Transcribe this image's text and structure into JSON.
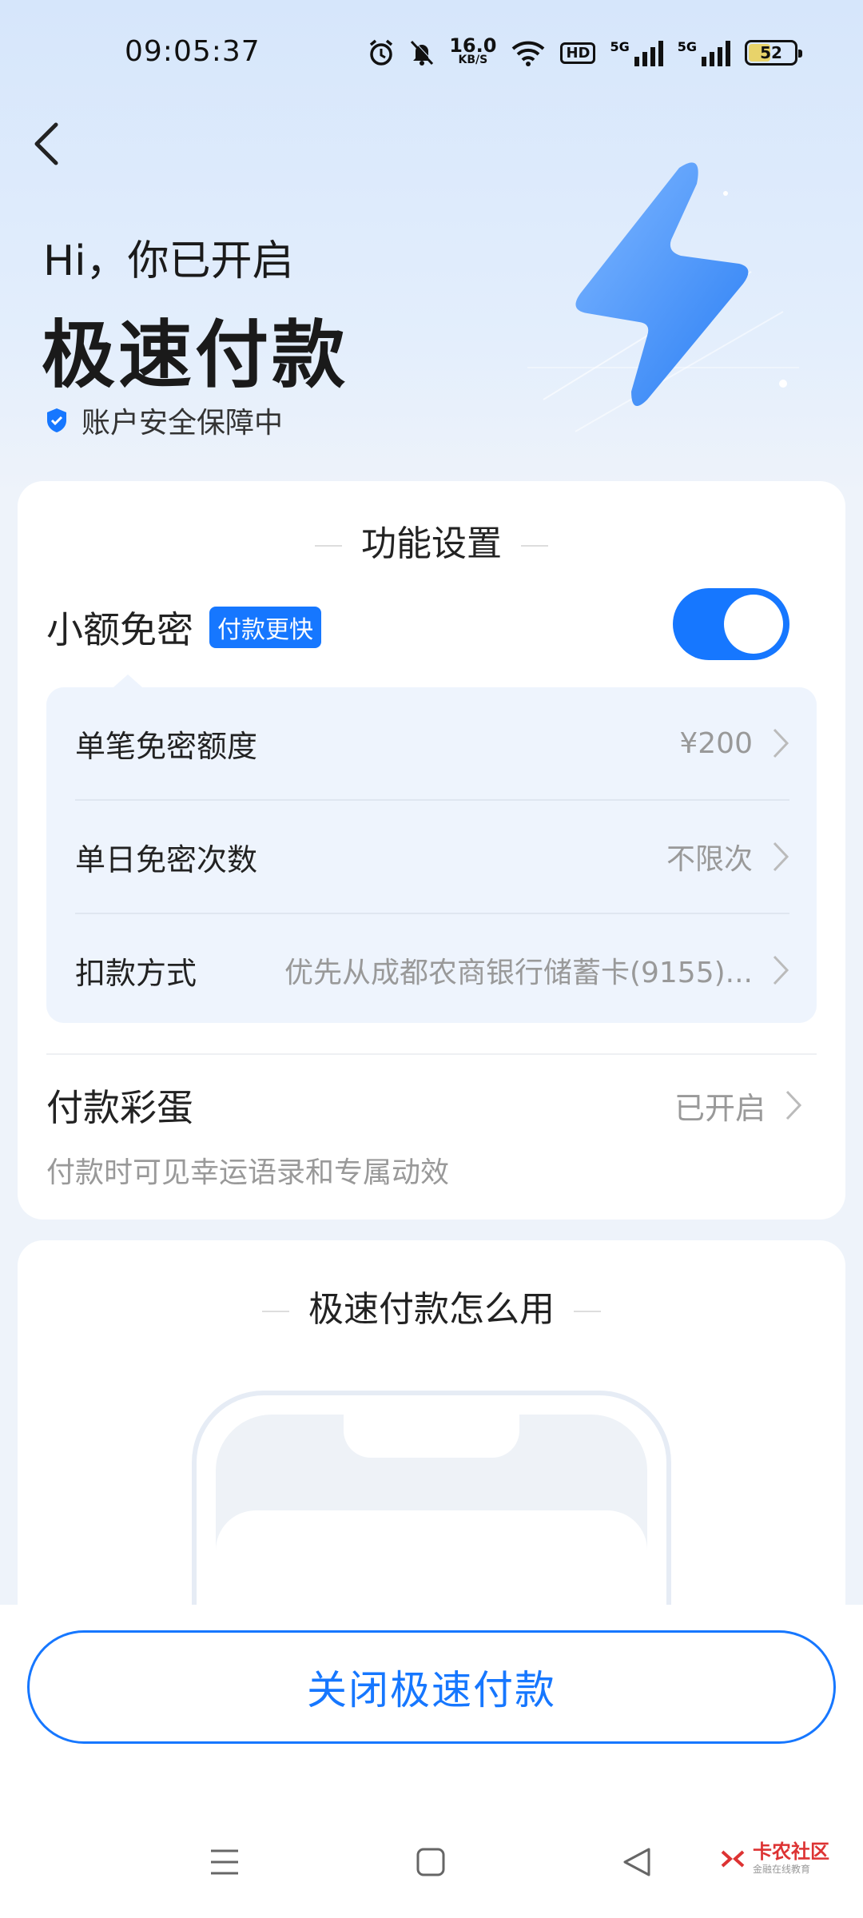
{
  "status_bar": {
    "time": "09:05:37",
    "net_speed_value": "16.0",
    "net_speed_unit": "KB/S",
    "hd_label": "HD",
    "sim1_label": "5G",
    "sim2_label": "5G",
    "battery_level": "52",
    "battery_fraction": 0.52,
    "icons": [
      "alarm-icon",
      "mute-bell-icon",
      "wifi-icon",
      "hd-voice-icon",
      "signal-icon",
      "signal-icon",
      "battery-icon"
    ]
  },
  "header": {
    "back_icon": "chevron-left-icon",
    "greeting": "Hi，你已开启",
    "title": "极速付款",
    "security_text": "账户安全保障中",
    "security_icon": "shield-check-icon"
  },
  "settings": {
    "section_title": "功能设置",
    "small_free": {
      "label": "小额免密",
      "badge": "付款更快",
      "enabled": true
    },
    "rows": [
      {
        "label": "单笔免密额度",
        "value": "¥200"
      },
      {
        "label": "单日免密次数",
        "value": "不限次"
      },
      {
        "label": "扣款方式",
        "value": "优先从成都农商银行储蓄卡(9155)..."
      }
    ],
    "easter_egg": {
      "label": "付款彩蛋",
      "value": "已开启",
      "description": "付款时可见幸运语录和专属动效"
    }
  },
  "howto": {
    "section_title": "极速付款怎么用"
  },
  "footer": {
    "close_button": "关闭极速付款"
  },
  "watermark": {
    "name": "卡农社区",
    "sub": "金融在线教育"
  },
  "colors": {
    "accent": "#1677ff",
    "battery": "#e8d36a"
  }
}
